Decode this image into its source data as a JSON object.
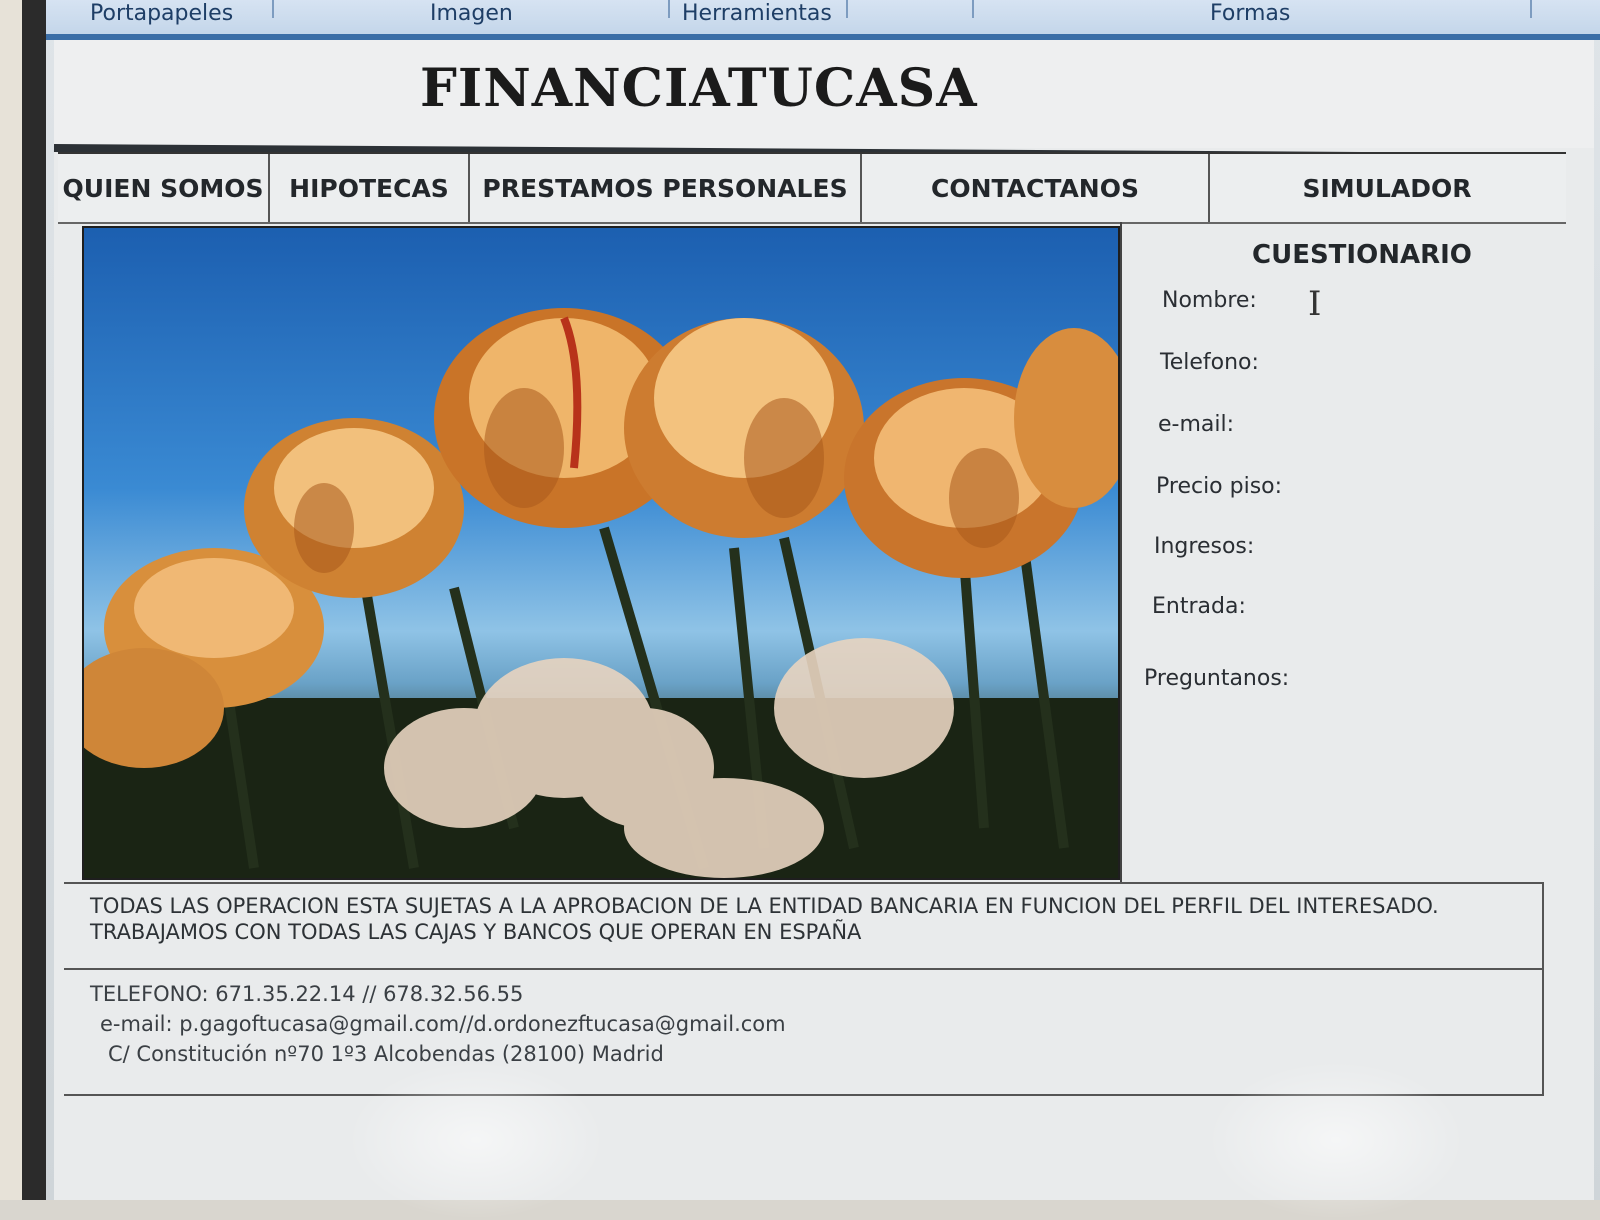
{
  "ribbon": {
    "groups": [
      "Portapapeles",
      "Imagen",
      "Herramientas",
      "Formas"
    ]
  },
  "site": {
    "title": "FINANCIATUCASA"
  },
  "nav": {
    "items": [
      "QUIEN SOMOS",
      "HIPOTECAS",
      "PRESTAMOS PERSONALES",
      "CONTACTANOS",
      "SIMULADOR"
    ]
  },
  "questionnaire": {
    "title": "CUESTIONARIO",
    "fields": [
      "Nombre:",
      "Telefono:",
      "e-mail:",
      "Precio piso:",
      "Ingresos:",
      "Entrada:",
      "Preguntanos:"
    ]
  },
  "disclaimer": {
    "line1": "TODAS LAS OPERACION ESTA SUJETAS A LA APROBACION DE LA ENTIDAD BANCARIA EN FUNCION DEL PERFIL DEL INTERESADO.",
    "line2": "TRABAJAMOS CON TODAS LAS CAJAS Y BANCOS QUE OPERAN EN ESPAÑA"
  },
  "contact": {
    "phone": "TELEFONO: 671.35.22.14 // 678.32.56.55",
    "email": "e-mail: p.gagoftucasa@gmail.com//d.ordonezftucasa@gmail.com",
    "address": "C/ Constitución nº70 1º3 Alcobendas (28100) Madrid"
  },
  "cursor": {
    "glyph": "I"
  }
}
